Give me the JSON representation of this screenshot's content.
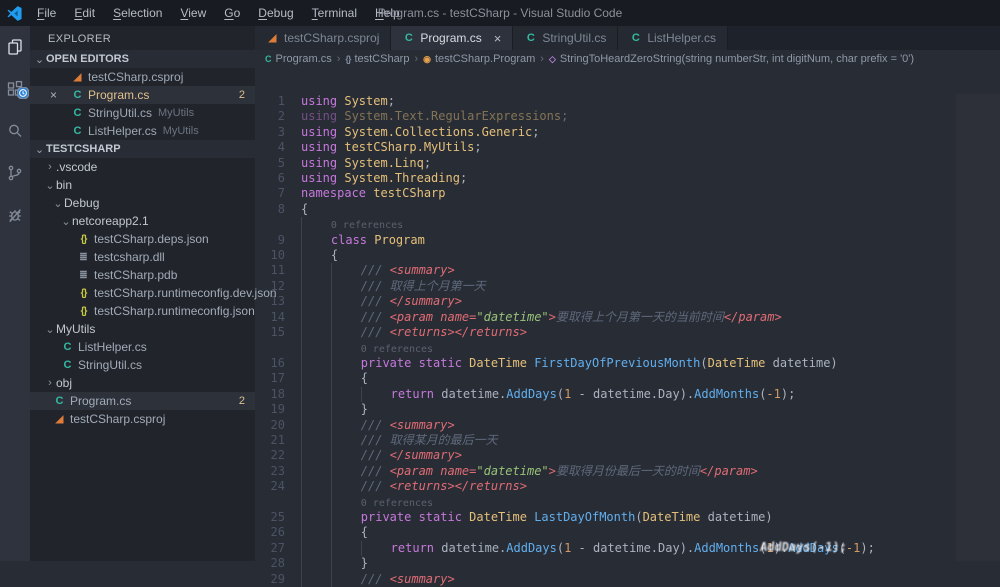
{
  "window": {
    "title": "Program.cs - testCSharp - Visual Studio Code",
    "menus": [
      "File",
      "Edit",
      "Selection",
      "View",
      "Go",
      "Debug",
      "Terminal",
      "Help"
    ]
  },
  "activity_bar": {
    "items": [
      {
        "icon": "explorer-icon",
        "active": true
      },
      {
        "icon": "extensions-icon",
        "badge": "clock"
      },
      {
        "icon": "search-icon"
      },
      {
        "icon": "source-control-icon"
      },
      {
        "icon": "debug-icon"
      }
    ]
  },
  "sidebar": {
    "title": "EXPLORER",
    "open_editors": {
      "header": "OPEN EDITORS",
      "items": [
        {
          "icon": "proj",
          "label": "testCSharp.csproj"
        },
        {
          "icon": "csharp",
          "label": "Program.cs",
          "active": true,
          "close": true,
          "badge": "2",
          "modified": true
        },
        {
          "icon": "csharp",
          "label": "StringUtil.cs",
          "suffix": "MyUtils"
        },
        {
          "icon": "csharp",
          "label": "ListHelper.cs",
          "suffix": "MyUtils"
        }
      ]
    },
    "tree": {
      "header": "TESTCSHARP",
      "items": [
        {
          "type": "folder",
          "state": "collapsed",
          "label": ".vscode",
          "ind": 0
        },
        {
          "type": "folder",
          "state": "expanded",
          "label": "bin",
          "ind": 0
        },
        {
          "type": "folder",
          "state": "expanded",
          "label": "Debug",
          "ind": 1
        },
        {
          "type": "folder",
          "state": "expanded",
          "label": "netcoreapp2.1",
          "ind": 2
        },
        {
          "type": "file",
          "icon": "json",
          "label": "testCSharp.deps.json",
          "ind": 3
        },
        {
          "type": "file",
          "icon": "dll",
          "label": "testcsharp.dll",
          "ind": 3
        },
        {
          "type": "file",
          "icon": "dll",
          "label": "testCSharp.pdb",
          "ind": 3
        },
        {
          "type": "file",
          "icon": "json",
          "label": "testCSharp.runtimeconfig.dev.json",
          "ind": 3
        },
        {
          "type": "file",
          "icon": "json",
          "label": "testCSharp.runtimeconfig.json",
          "ind": 3
        },
        {
          "type": "folder",
          "state": "expanded",
          "label": "MyUtils",
          "ind": 0
        },
        {
          "type": "file",
          "icon": "csharp",
          "label": "ListHelper.cs",
          "ind": 1
        },
        {
          "type": "file",
          "icon": "csharp",
          "label": "StringUtil.cs",
          "ind": 1
        },
        {
          "type": "folder",
          "state": "collapsed",
          "label": "obj",
          "ind": 0
        },
        {
          "type": "file",
          "icon": "csharp",
          "label": "Program.cs",
          "ind": 0,
          "badge": "2",
          "selected": true
        },
        {
          "type": "file",
          "icon": "proj",
          "label": "testCSharp.csproj",
          "ind": 0
        }
      ]
    }
  },
  "editor": {
    "tabs": [
      {
        "icon": "proj",
        "label": "testCSharp.csproj"
      },
      {
        "icon": "csharp",
        "label": "Program.cs",
        "active": true,
        "close": true
      },
      {
        "icon": "csharp",
        "label": "StringUtil.cs"
      },
      {
        "icon": "csharp",
        "label": "ListHelper.cs"
      }
    ],
    "breadcrumbs": [
      {
        "icon": "csharp",
        "label": "Program.cs"
      },
      {
        "icon": "namespace",
        "label": "testCSharp"
      },
      {
        "icon": "class",
        "label": "testCSharp.Program"
      },
      {
        "icon": "method",
        "label": "StringToHeardZeroString(string numberStr, int digitNum, char prefix = '0')"
      }
    ],
    "codelens_label": "0 references",
    "ghost_text": "AddDays(-1);",
    "lines": [
      {
        "n": 1,
        "ind": 0,
        "tok": [
          [
            "k",
            "using "
          ],
          [
            "t",
            "System"
          ],
          [
            "v",
            ";"
          ]
        ]
      },
      {
        "n": 2,
        "ind": 0,
        "dim": true,
        "tok": [
          [
            "k",
            "using "
          ],
          [
            "t",
            "System.Text.RegularExpressions"
          ],
          [
            "v",
            ";"
          ]
        ]
      },
      {
        "n": 3,
        "ind": 0,
        "tok": [
          [
            "k",
            "using "
          ],
          [
            "t",
            "System.Collections.Generic"
          ],
          [
            "v",
            ";"
          ]
        ]
      },
      {
        "n": 4,
        "ind": 0,
        "tok": [
          [
            "k",
            "using "
          ],
          [
            "t",
            "testCSharp.MyUtils"
          ],
          [
            "v",
            ";"
          ]
        ]
      },
      {
        "n": 5,
        "ind": 0,
        "tok": [
          [
            "k",
            "using "
          ],
          [
            "t",
            "System.Linq"
          ],
          [
            "v",
            ";"
          ]
        ]
      },
      {
        "n": 6,
        "ind": 0,
        "tok": [
          [
            "k",
            "using "
          ],
          [
            "t",
            "System.Threading"
          ],
          [
            "v",
            ";"
          ]
        ]
      },
      {
        "n": 7,
        "ind": 0,
        "tok": [
          [
            "k",
            "namespace "
          ],
          [
            "t",
            "testCSharp"
          ]
        ]
      },
      {
        "n": 8,
        "ind": 0,
        "tok": [
          [
            "v",
            "{"
          ]
        ]
      },
      {
        "lens": true,
        "ind": 1
      },
      {
        "n": 9,
        "ind": 1,
        "tok": [
          [
            "k",
            "class "
          ],
          [
            "t",
            "Program"
          ]
        ]
      },
      {
        "n": 10,
        "ind": 1,
        "tok": [
          [
            "v",
            "{"
          ]
        ]
      },
      {
        "n": 11,
        "ind": 2,
        "tok": [
          [
            "c",
            "/// "
          ],
          [
            "tag",
            "<summary>"
          ]
        ]
      },
      {
        "n": 12,
        "ind": 2,
        "tok": [
          [
            "c",
            "/// 取得上个月第一天"
          ]
        ]
      },
      {
        "n": 13,
        "ind": 2,
        "tok": [
          [
            "c",
            "/// "
          ],
          [
            "tag",
            "</summary>"
          ]
        ]
      },
      {
        "n": 14,
        "ind": 2,
        "tok": [
          [
            "c",
            "/// "
          ],
          [
            "tag",
            "<param name="
          ],
          [
            "s",
            "\"datetime\""
          ],
          [
            "tag",
            ">"
          ],
          [
            "c",
            "要取得上个月第一天的当前时间"
          ],
          [
            "tag",
            "</param>"
          ]
        ]
      },
      {
        "n": 15,
        "ind": 2,
        "tok": [
          [
            "c",
            "/// "
          ],
          [
            "tag",
            "<returns></returns>"
          ]
        ]
      },
      {
        "lens": true,
        "ind": 2
      },
      {
        "n": 16,
        "ind": 2,
        "tok": [
          [
            "k",
            "private static "
          ],
          [
            "t",
            "DateTime "
          ],
          [
            "f",
            "FirstDayOfPreviousMonth"
          ],
          [
            "v",
            "("
          ],
          [
            "t",
            "DateTime"
          ],
          [
            "v",
            " datetime)"
          ]
        ]
      },
      {
        "n": 17,
        "ind": 2,
        "tok": [
          [
            "v",
            "{"
          ]
        ]
      },
      {
        "n": 18,
        "ind": 3,
        "tok": [
          [
            "k",
            "return "
          ],
          [
            "v",
            "datetime."
          ],
          [
            "f",
            "AddDays"
          ],
          [
            "v",
            "("
          ],
          [
            "n",
            "1"
          ],
          [
            "v",
            " - datetime.Day)."
          ],
          [
            "f",
            "AddMonths"
          ],
          [
            "v",
            "("
          ],
          [
            "n",
            "-1"
          ],
          [
            "v",
            ");"
          ]
        ]
      },
      {
        "n": 19,
        "ind": 2,
        "tok": [
          [
            "v",
            "}"
          ]
        ]
      },
      {
        "n": 20,
        "ind": 2,
        "tok": [
          [
            "c",
            "/// "
          ],
          [
            "tag",
            "<summary>"
          ]
        ]
      },
      {
        "n": 21,
        "ind": 2,
        "tok": [
          [
            "c",
            "/// 取得某月的最后一天"
          ]
        ]
      },
      {
        "n": 22,
        "ind": 2,
        "tok": [
          [
            "c",
            "/// "
          ],
          [
            "tag",
            "</summary>"
          ]
        ]
      },
      {
        "n": 23,
        "ind": 2,
        "tok": [
          [
            "c",
            "/// "
          ],
          [
            "tag",
            "<param name="
          ],
          [
            "s",
            "\"datetime\""
          ],
          [
            "tag",
            ">"
          ],
          [
            "c",
            "要取得月份最后一天的时间"
          ],
          [
            "tag",
            "</param>"
          ]
        ]
      },
      {
        "n": 24,
        "ind": 2,
        "tok": [
          [
            "c",
            "/// "
          ],
          [
            "tag",
            "<returns></returns>"
          ]
        ]
      },
      {
        "lens": true,
        "ind": 2
      },
      {
        "n": 25,
        "ind": 2,
        "tok": [
          [
            "k",
            "private static "
          ],
          [
            "t",
            "DateTime "
          ],
          [
            "f",
            "LastDayOfMonth"
          ],
          [
            "v",
            "("
          ],
          [
            "t",
            "DateTime"
          ],
          [
            "v",
            " datetime)"
          ]
        ]
      },
      {
        "n": 26,
        "ind": 2,
        "tok": [
          [
            "v",
            "{"
          ]
        ]
      },
      {
        "n": 27,
        "ind": 3,
        "ghost": true,
        "tok": [
          [
            "k",
            "return "
          ],
          [
            "v",
            "datetime."
          ],
          [
            "f",
            "AddDays"
          ],
          [
            "v",
            "("
          ],
          [
            "n",
            "1"
          ],
          [
            "v",
            " - datetime.Day)."
          ],
          [
            "f",
            "AddMonths"
          ],
          [
            "v",
            "("
          ],
          [
            "n",
            "1"
          ],
          [
            "v",
            ")."
          ],
          [
            "f",
            "AddDays"
          ],
          [
            "v",
            "("
          ],
          [
            "n",
            "-1"
          ],
          [
            "v",
            ");"
          ]
        ]
      },
      {
        "n": 28,
        "ind": 2,
        "tok": [
          [
            "v",
            "}"
          ]
        ]
      },
      {
        "n": 29,
        "ind": 2,
        "tok": [
          [
            "c",
            "/// "
          ],
          [
            "tag",
            "<summary>"
          ]
        ]
      }
    ]
  },
  "colors": {
    "accent_blue": "#2e82d6",
    "modified_yellow": "#e2c08d",
    "keyword": "#c678dd",
    "type": "#e5c07b",
    "function": "#61afef",
    "number": "#d19a66",
    "string": "#98c379",
    "doc_tag": "#e06c75",
    "comment": "#5f6a7d",
    "editor_bg": "#282c34",
    "sidebar_bg": "#21252b",
    "activitybar_bg": "#2f333d",
    "titlebar_bg": "#181b21"
  }
}
